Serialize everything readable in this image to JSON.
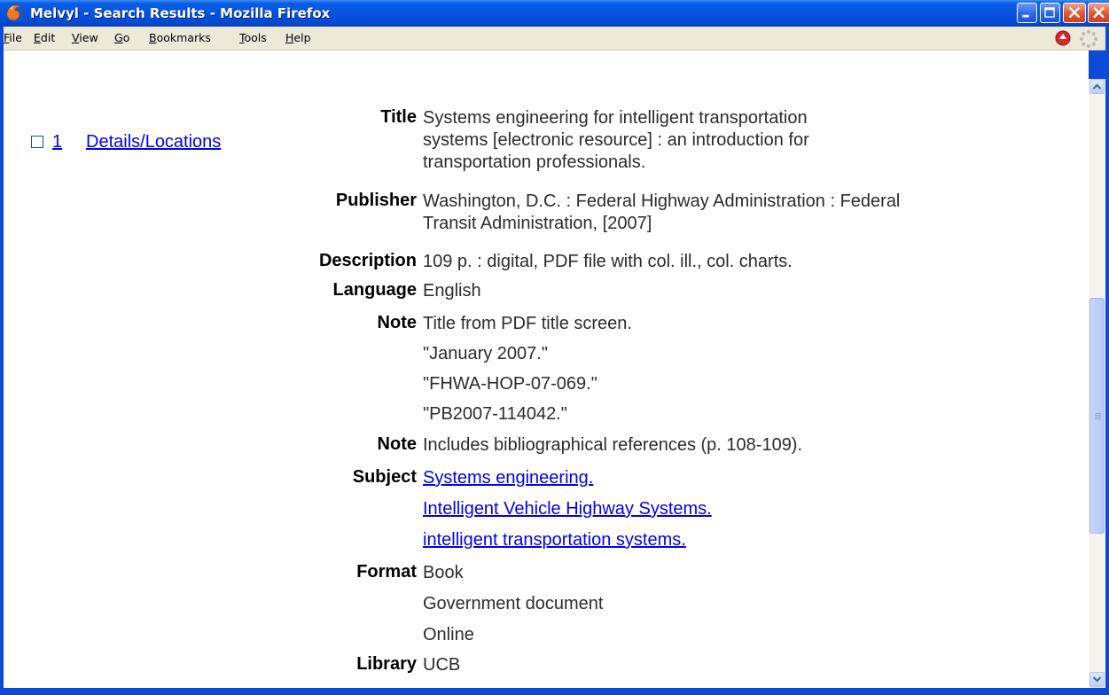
{
  "window": {
    "title": "Melvyl - Search Results - Mozilla Firefox"
  },
  "menu": [
    {
      "acc": "F",
      "rest": "ile"
    },
    {
      "acc": "E",
      "rest": "dit"
    },
    {
      "acc": "V",
      "rest": "iew"
    },
    {
      "acc": "G",
      "rest": "o"
    },
    {
      "acc": "B",
      "rest": "ookmarks"
    },
    {
      "acc": "T",
      "rest": "ools"
    },
    {
      "acc": "H",
      "rest": "elp"
    }
  ],
  "record": {
    "number": "1",
    "details_link": "Details/Locations",
    "labels": {
      "title": "Title",
      "publisher": "Publisher",
      "description": "Description",
      "language": "Language",
      "note1": "Note",
      "note2": "Note",
      "subject": "Subject",
      "format": "Format",
      "library": "Library"
    },
    "title": [
      "Systems engineering for intelligent transportation",
      "systems [electronic resource] : an introduction for",
      "transportation professionals."
    ],
    "publisher": [
      "Washington, D.C. : Federal Highway Administration : Federal",
      "Transit Administration, [2007]"
    ],
    "description": "109 p. : digital, PDF file with col. ill., col. charts.",
    "language": "English",
    "notes_group1": [
      "Title from PDF title screen.",
      "\"January 2007.\"",
      "\"FHWA-HOP-07-069.\"",
      "\"PB2007-114042.\""
    ],
    "note2": "Includes bibliographical references (p. 108-109).",
    "subjects": [
      "Systems engineering.",
      "Intelligent Vehicle Highway Systems.",
      "intelligent transportation systems."
    ],
    "formats": [
      "Book",
      "Government document",
      "Online"
    ],
    "library": "UCB"
  }
}
